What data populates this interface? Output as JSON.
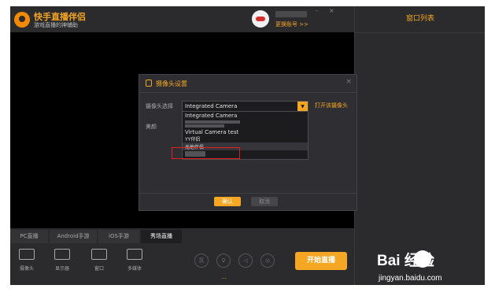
{
  "app": {
    "name": "快手直播伴侣",
    "subtitle": "游戏直播的神辅助",
    "switch_account": "更换账号 >>",
    "window_controls": [
      "-",
      "×"
    ]
  },
  "right_panel": {
    "title": "窗口列表"
  },
  "dialog": {
    "title": "摄像头设置",
    "camera_label": "摄像头选择",
    "beauty_label": "美颜",
    "selected_camera": "Integrated Camera",
    "open_camera": "打开该摄像头",
    "options": [
      "Integrated Camera",
      "Virtual Camera test",
      "YY伴侣",
      "无他伴侣"
    ],
    "confirm": "确认",
    "cancel": "取消"
  },
  "tabs": [
    {
      "label": "PC直播",
      "active": false
    },
    {
      "label": "Android手游",
      "active": false
    },
    {
      "label": "iOS手游",
      "active": false
    },
    {
      "label": "秀场直播",
      "active": true
    }
  ],
  "sources": [
    {
      "label": "摄像头",
      "icon": "camera-icon"
    },
    {
      "label": "显示器",
      "icon": "monitor-icon"
    },
    {
      "label": "窗口",
      "icon": "window-icon"
    },
    {
      "label": "多媒体",
      "icon": "media-icon"
    }
  ],
  "controls": [
    {
      "glyph": "氛",
      "icon": "atmosphere-icon"
    },
    {
      "glyph": "♀",
      "icon": "microphone-icon"
    },
    {
      "glyph": "◁",
      "icon": "speaker-icon"
    },
    {
      "glyph": "◎",
      "icon": "settings-icon"
    }
  ],
  "controls_more": "...",
  "start_button": "开始直播",
  "watermark": {
    "brand": "Bai  经验",
    "url": "jingyan.baidu.com"
  }
}
